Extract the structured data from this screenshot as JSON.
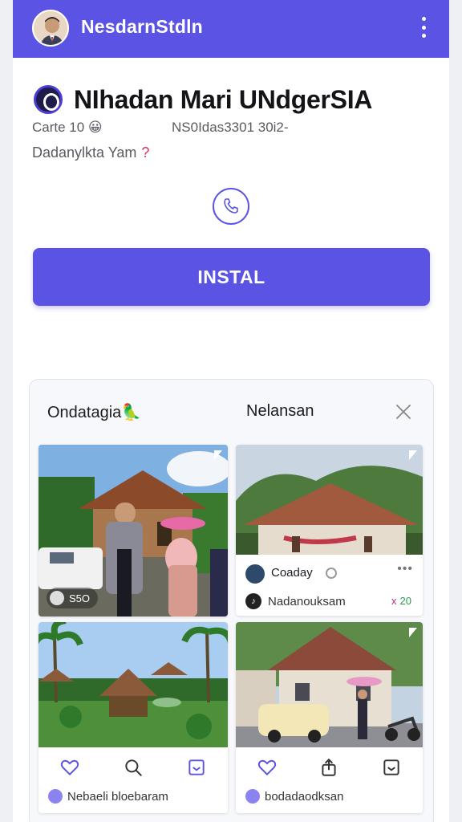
{
  "appbar": {
    "title": "NesdarnStdln",
    "avatar_icon": "user-avatar",
    "menu_icon": "kebab-menu-icon",
    "color": "#5b53e4"
  },
  "app": {
    "logo_icon": "app-logo-icon",
    "title": "NIhadan Mari UNdgerSIA",
    "meta_left": "Carte 10 😀",
    "meta_right": "NS0Idas3301 30i2-",
    "subtitle": "Dadanylkta Yam",
    "subtitle_mark": "?",
    "call_icon": "phone-icon",
    "install_label": "INSTAL"
  },
  "gallery": {
    "tab_left": "Ondatagia🦜",
    "tab_right": "Nelansan",
    "close_icon": "close-icon",
    "tiles": [
      {
        "caption": "S5O",
        "scene": "village-house-with-people"
      },
      {
        "scene": "traditional-house-with-hills",
        "post": {
          "name": "Coaday",
          "handle": "Nadanouksam",
          "extra_x": "x",
          "extra_n": "20",
          "more": "•••"
        }
      },
      {
        "scene": "tropical-resort-huts",
        "footer": "Nebaeli bloebaram",
        "actions": [
          "heart-icon",
          "search-icon",
          "bookmark-icon"
        ]
      },
      {
        "scene": "house-street-car-motorbike",
        "footer": "bodadaodksan",
        "actions": [
          "heart-icon",
          "share-icon",
          "bookmark-icon"
        ]
      }
    ]
  }
}
